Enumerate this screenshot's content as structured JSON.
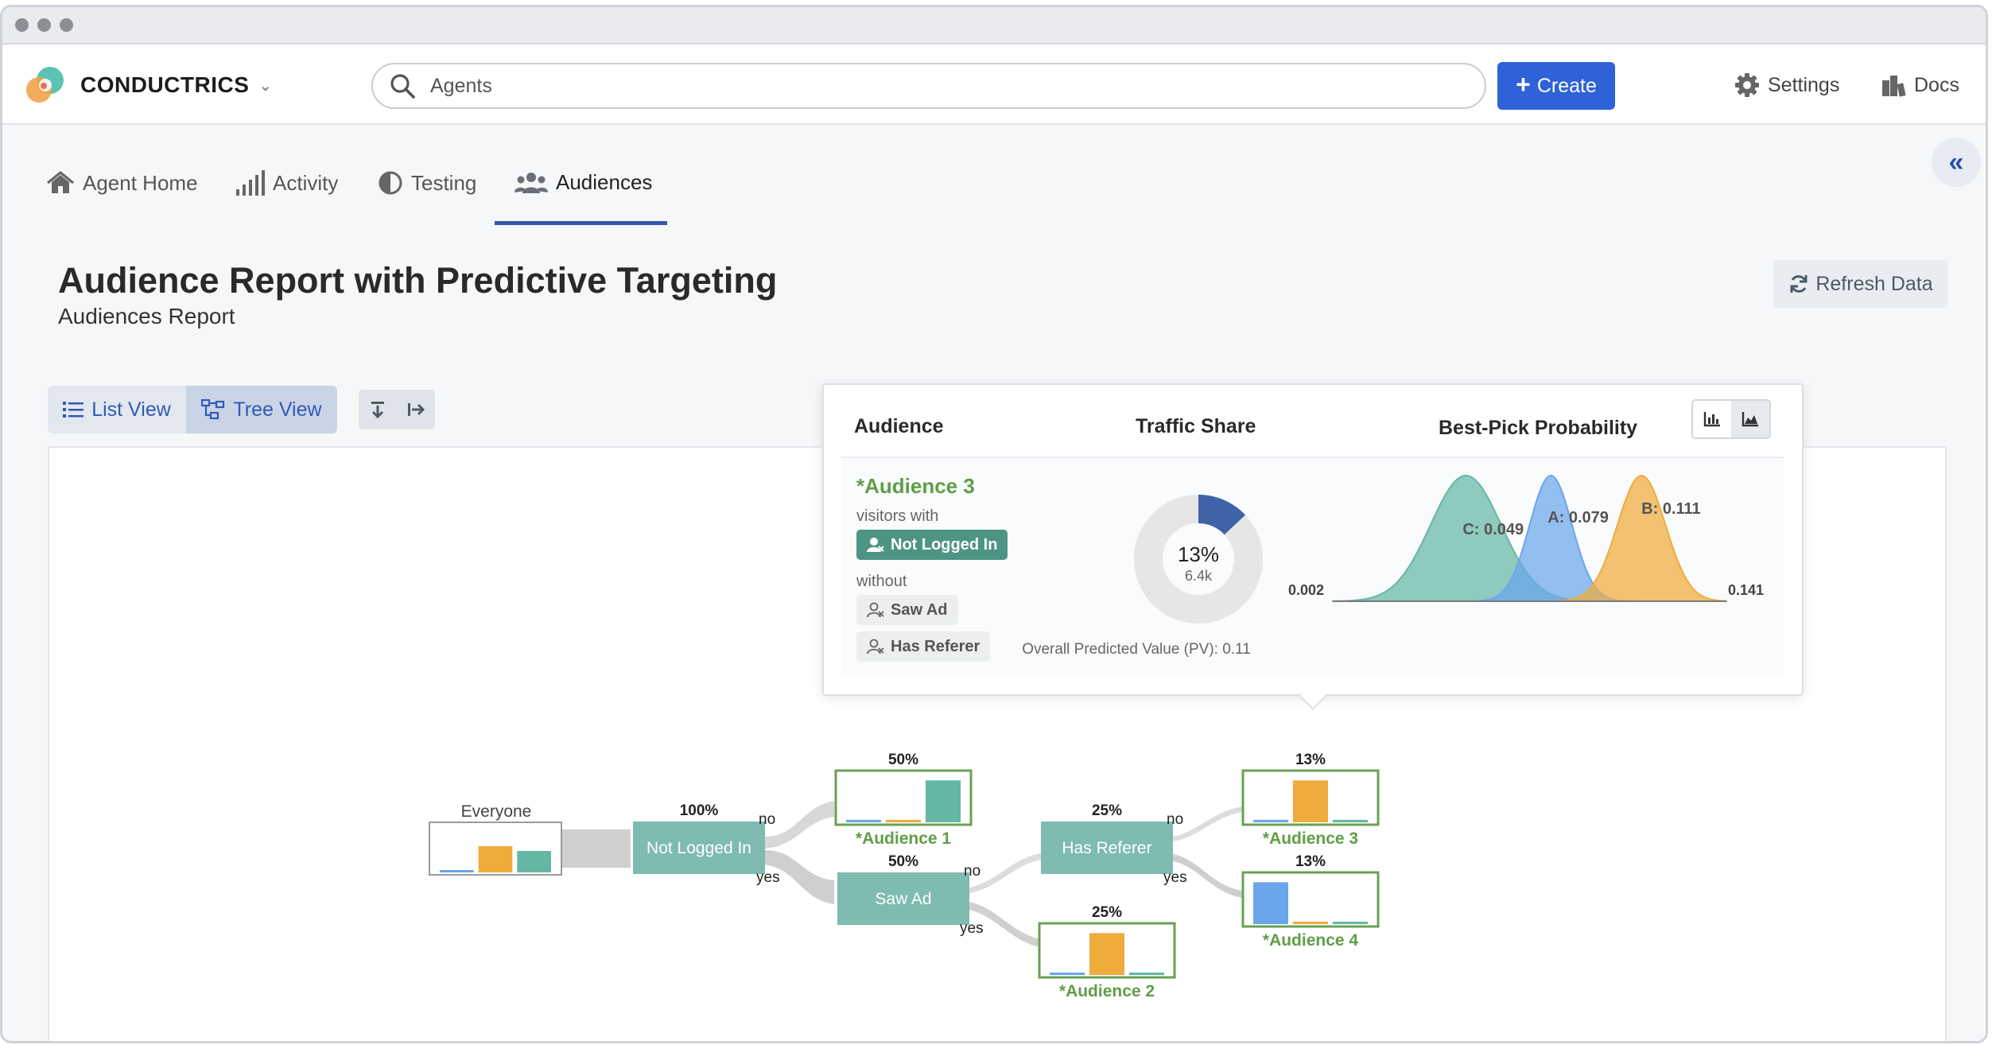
{
  "window": {
    "dots": 3
  },
  "header": {
    "brand": "CONDUCTRICS",
    "search_placeholder": "Agents",
    "create_label": "Create",
    "settings_label": "Settings",
    "docs_label": "Docs"
  },
  "tabs": [
    {
      "label": "Agent Home",
      "icon": "home-icon"
    },
    {
      "label": "Activity",
      "icon": "bar-signal-icon"
    },
    {
      "label": "Testing",
      "icon": "half-circle-icon"
    },
    {
      "label": "Audiences",
      "icon": "users-icon",
      "active": true
    }
  ],
  "page": {
    "title": "Audience Report with Predictive Targeting",
    "subtitle": "Audiences Report",
    "refresh_label": "Refresh Data"
  },
  "view_toggle": {
    "list_label": "List View",
    "tree_label": "Tree View",
    "selected": "tree"
  },
  "popup": {
    "col_audience": "Audience",
    "col_traffic": "Traffic Share",
    "col_probability": "Best-Pick Probability",
    "audience_name": "*Audience 3",
    "with_label": "visitors with",
    "with_badge": "Not Logged In",
    "without_label": "without",
    "without_badges": [
      "Saw Ad",
      "Has Referer"
    ],
    "traffic_pct": "13%",
    "traffic_count": "6.4k",
    "traffic_fraction": 0.13,
    "dist_min_label": "0.002",
    "dist_max_label": "0.141",
    "pv_label": "Overall Predicted Value (PV): 0.11"
  },
  "colors": {
    "A": "#6aa6ec",
    "B": "#efac3d",
    "C": "#64b7a5",
    "node": "#7ebbb0",
    "accent": "#2f62d8",
    "green_text": "#5f9e47"
  },
  "chart_data": {
    "type": "area",
    "title": "Best-Pick Probability",
    "xlabel": "Overall Predicted Value (PV): 0.11",
    "xlim": [
      0.002,
      0.141
    ],
    "series": [
      {
        "name": "C",
        "mean": 0.049,
        "label": "C: 0.049"
      },
      {
        "name": "A",
        "mean": 0.079,
        "label": "A: 0.079"
      },
      {
        "name": "B",
        "mean": 0.111,
        "label": "B: 0.111"
      }
    ]
  },
  "tree": {
    "root": {
      "label": "Everyone",
      "bars": [
        0.05,
        0.55,
        0.45
      ]
    },
    "nodes": [
      {
        "label": "Not Logged In",
        "pct": "100%"
      },
      {
        "label": "Saw Ad",
        "pct": "50%"
      },
      {
        "label": "Has Referer",
        "pct": "25%"
      }
    ],
    "leaves": [
      {
        "label": "*Audience 1",
        "pct": "50%",
        "bars": [
          0.05,
          0.05,
          0.85
        ]
      },
      {
        "label": "*Audience 2",
        "pct": "25%",
        "bars": [
          0.05,
          0.85,
          0.05
        ]
      },
      {
        "label": "*Audience 3",
        "pct": "13%",
        "bars": [
          0.05,
          0.85,
          0.05
        ]
      },
      {
        "label": "*Audience 4",
        "pct": "13%",
        "bars": [
          0.85,
          0.05,
          0.05
        ]
      }
    ],
    "edge_no": "no",
    "edge_yes": "yes"
  }
}
